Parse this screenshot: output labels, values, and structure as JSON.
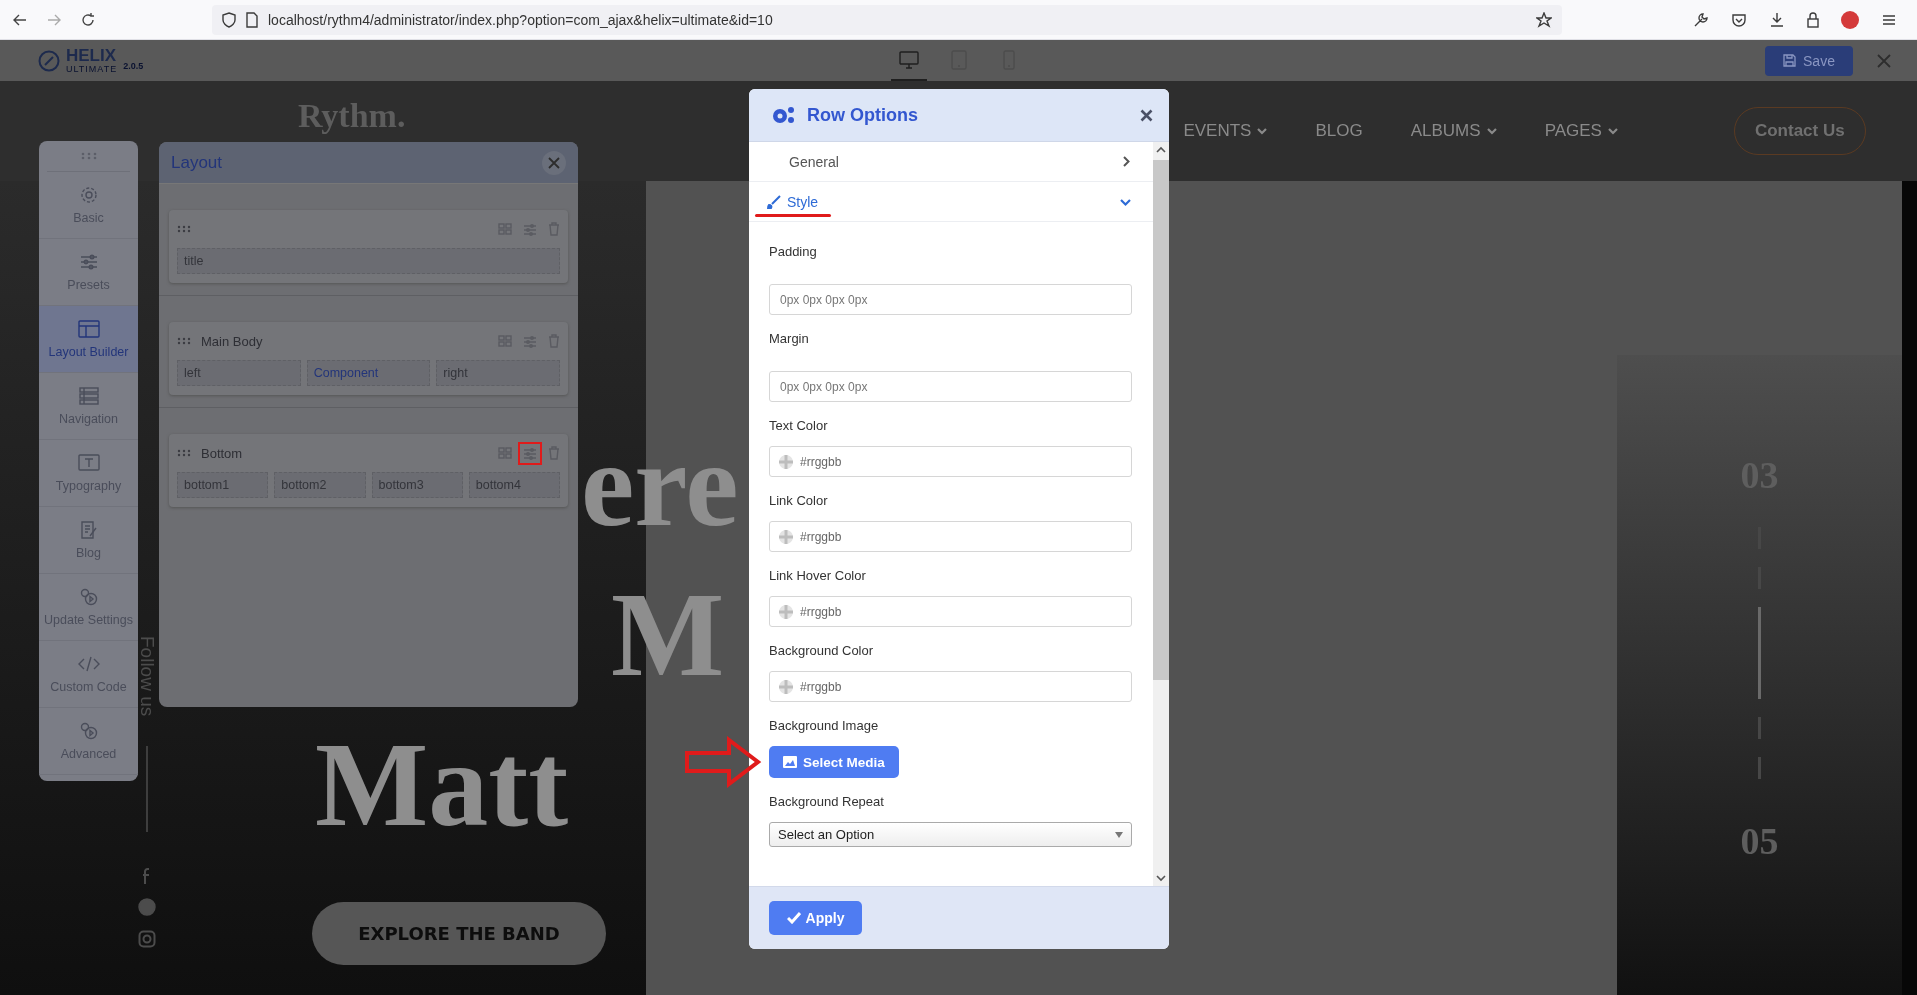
{
  "browser": {
    "url": "localhost/rythm4/administrator/index.php?option=com_ajax&helix=ultimate&id=10"
  },
  "builder_bar": {
    "logo": "HELIX",
    "logo_sub": "ULTIMATE",
    "version": "2.0.5",
    "save": "Save",
    "devices": [
      {
        "kind": "desktop",
        "selected": true
      },
      {
        "kind": "tablet",
        "selected": false
      },
      {
        "kind": "mobile",
        "selected": false
      }
    ]
  },
  "sidebar": {
    "items": [
      {
        "kind": "gear",
        "label": "Basic",
        "selected": false
      },
      {
        "kind": "sliders",
        "label": "Presets",
        "selected": false
      },
      {
        "kind": "layout",
        "label": "Layout Builder",
        "selected": true
      },
      {
        "kind": "list",
        "label": "Navigation",
        "selected": false
      },
      {
        "kind": "type",
        "label": "Typography",
        "selected": false
      },
      {
        "kind": "doc",
        "label": "Blog",
        "selected": false
      },
      {
        "kind": "gears",
        "label": "Update Settings",
        "selected": false
      },
      {
        "kind": "code",
        "label": "Custom Code",
        "selected": false
      },
      {
        "kind": "gears",
        "label": "Advanced",
        "selected": false
      }
    ]
  },
  "layout_panel": {
    "title": "Layout",
    "rows": [
      {
        "highlighted": false,
        "columns": [
          {
            "label": "title",
            "selected": false
          }
        ]
      },
      {
        "name": "Main Body",
        "highlighted": false,
        "columns": [
          {
            "label": "left",
            "selected": false
          },
          {
            "label": "Component",
            "selected": true
          },
          {
            "label": "right",
            "selected": false
          }
        ]
      },
      {
        "name": "Bottom",
        "highlighted": true,
        "columns": [
          {
            "label": "bottom1",
            "selected": false
          },
          {
            "label": "bottom2",
            "selected": false
          },
          {
            "label": "bottom3",
            "selected": false
          },
          {
            "label": "bottom4",
            "selected": false
          }
        ]
      }
    ]
  },
  "site": {
    "logo": "Rythm.",
    "contact": "Contact Us",
    "follow": "Follow us",
    "explore": "EXPLORE THE BAND",
    "nav": [
      {
        "label": "EVENTS",
        "dropdown": true
      },
      {
        "label": "BLOG",
        "dropdown": false
      },
      {
        "label": "ALBUMS",
        "dropdown": true
      },
      {
        "label": "PAGES",
        "dropdown": true
      }
    ],
    "hero_lines": [
      "ere",
      "M",
      "Matt"
    ],
    "slide_numbers": [
      "03",
      "05"
    ],
    "slide_marks": [
      {
        "selected": false
      },
      {
        "selected": false
      },
      {
        "selected": true
      },
      {
        "selected": false
      },
      {
        "selected": false
      }
    ]
  },
  "dialog": {
    "title": "Row Options",
    "apply": "Apply",
    "sections": [
      {
        "label": "General",
        "expanded": false,
        "underlined": false
      },
      {
        "label": "Style",
        "expanded": true,
        "underlined": true
      }
    ],
    "fields": [
      {
        "kind": "text",
        "label": "Padding",
        "placeholder": "0px 0px 0px 0px"
      },
      {
        "kind": "text",
        "label": "Margin",
        "placeholder": "0px 0px 0px 0px"
      },
      {
        "kind": "color",
        "label": "Text Color",
        "placeholder": "#rrggbb"
      },
      {
        "kind": "color",
        "label": "Link Color",
        "placeholder": "#rrggbb"
      },
      {
        "kind": "color",
        "label": "Link Hover Color",
        "placeholder": "#rrggbb"
      },
      {
        "kind": "color",
        "label": "Background Color",
        "placeholder": "#rrggbb"
      },
      {
        "kind": "media",
        "label": "Background Image",
        "button": "Select Media",
        "pointed": true
      },
      {
        "kind": "select",
        "label": "Background Repeat",
        "value": "Select an Option"
      }
    ]
  }
}
